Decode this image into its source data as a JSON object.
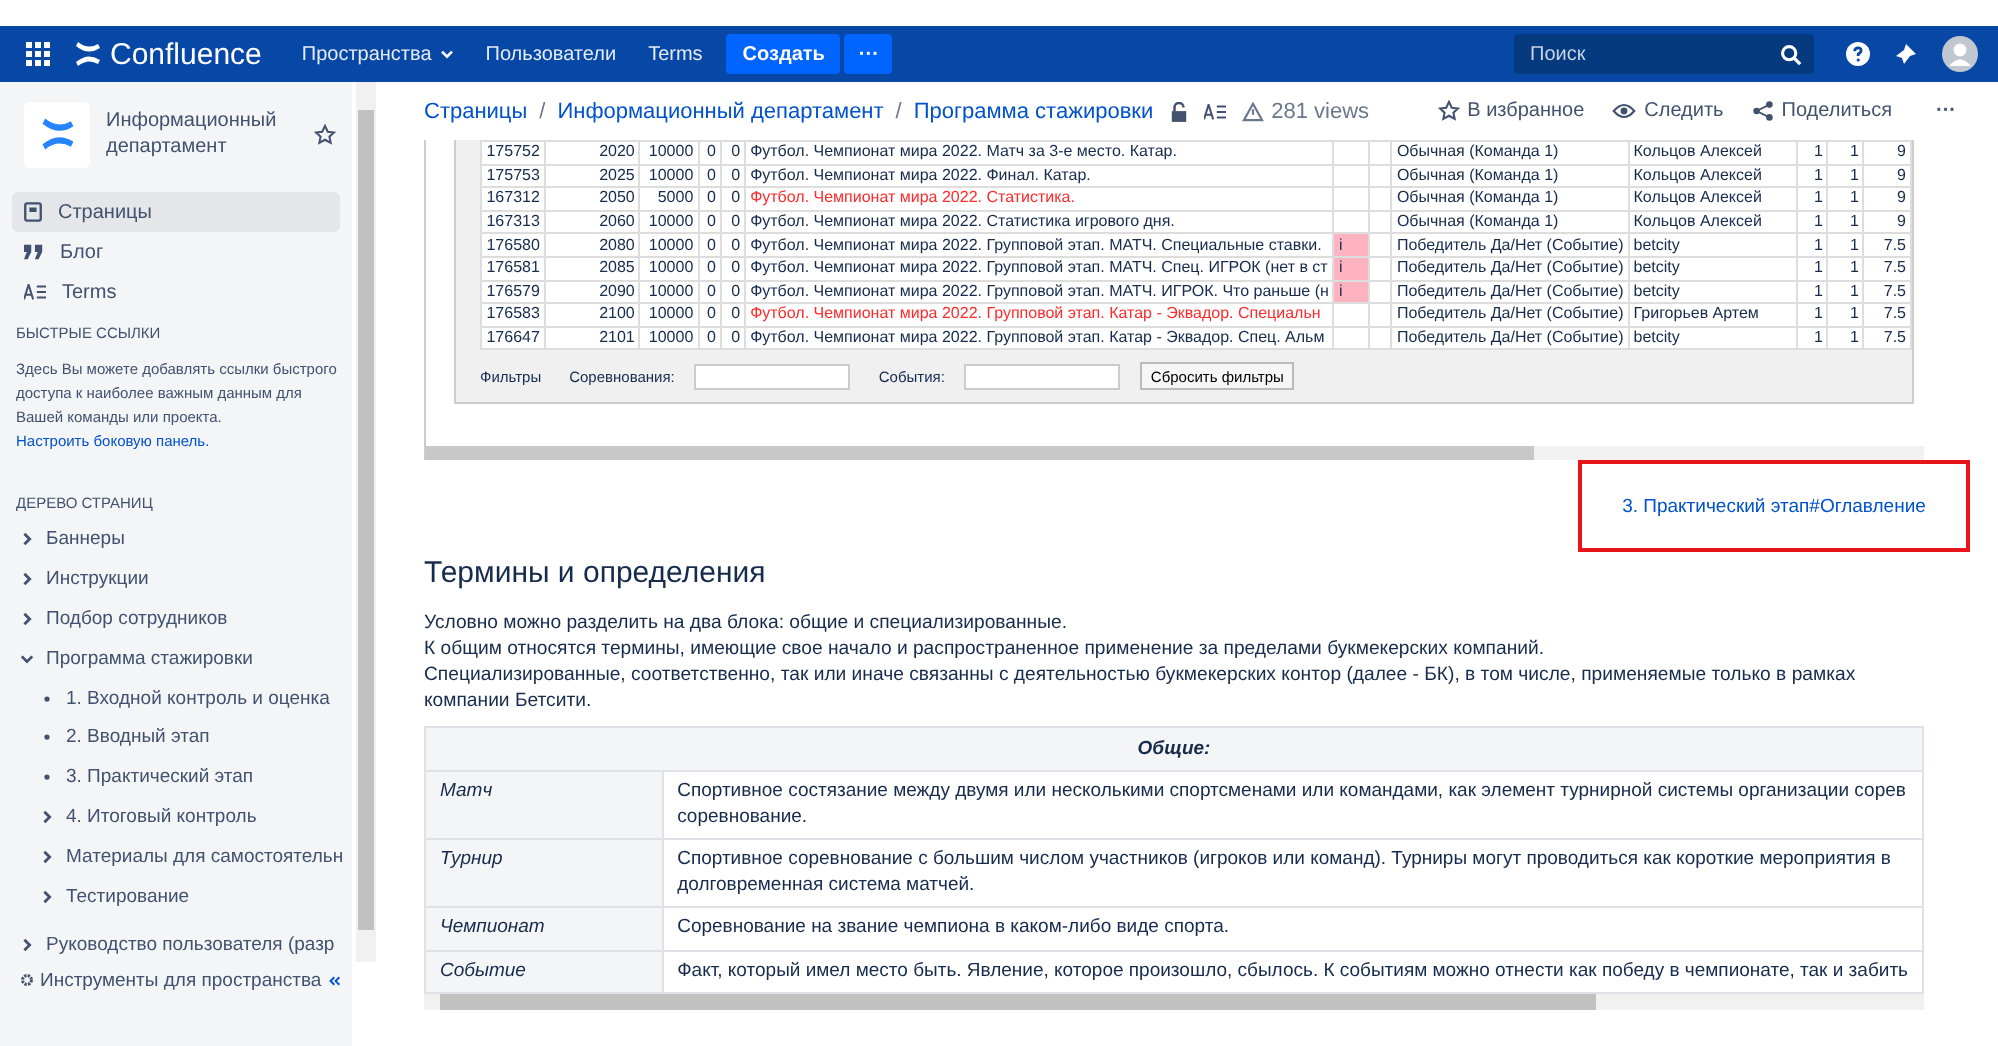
{
  "topbar": {
    "product": "Confluence",
    "menu": [
      {
        "label": "Пространства",
        "dropdown": true
      },
      {
        "label": "Пользователи",
        "dropdown": false
      },
      {
        "label": "Terms",
        "dropdown": false
      }
    ],
    "create": "Создать",
    "more": "···",
    "search": {
      "placeholder": "Поиск"
    }
  },
  "sidebar": {
    "space": "Информационный департамент",
    "nav": [
      {
        "kind": "pages",
        "label": "Страницы",
        "selected": true
      },
      {
        "kind": "blog",
        "label": "Блог",
        "selected": false
      },
      {
        "kind": "terms",
        "label": "Terms",
        "selected": false
      }
    ],
    "quick_links_title": "БЫСТРЫЕ ССЫЛКИ",
    "quick_links_text": "Здесь Вы можете добавлять ссылки быстрого доступа к наиболее важным данным для Вашей команды или проекта.",
    "quick_links_link": "Настроить боковую панель.",
    "tree_title": "ДЕРЕВО СТРАНИЦ",
    "tree": [
      {
        "label": "Баннеры",
        "kind": "branch",
        "expanded": false
      },
      {
        "label": "Инструкции",
        "kind": "branch",
        "expanded": false
      },
      {
        "label": "Подбор сотрудников",
        "kind": "branch",
        "expanded": false
      },
      {
        "label": "Программа стажировки",
        "kind": "branch",
        "expanded": true,
        "children": [
          {
            "label": "1. Входной контроль и оценка",
            "kind": "leaf"
          },
          {
            "label": "2. Вводный этап",
            "kind": "leaf"
          },
          {
            "label": "3. Практический этап",
            "kind": "leaf"
          },
          {
            "label": "4. Итоговый контроль",
            "kind": "branch",
            "expanded": false
          },
          {
            "label": "Материалы для самостоятельн",
            "kind": "branch",
            "expanded": false
          },
          {
            "label": "Тестирование",
            "kind": "branch",
            "expanded": false
          }
        ]
      }
    ],
    "tree_more": [
      {
        "label": "Руководство пользователя (разр",
        "kind": "branch",
        "expanded": false
      }
    ],
    "tools": "Инструменты для пространства"
  },
  "breadcrumbs": [
    "Страницы",
    "Информационный департамент",
    "Программа стажировки"
  ],
  "breadcrumb_separator": "/",
  "views": "281 views",
  "actions": [
    {
      "kind": "star",
      "label": "В избранное"
    },
    {
      "kind": "watch",
      "label": "Следить"
    },
    {
      "kind": "share",
      "label": "Поделиться"
    }
  ],
  "actions_more": "···",
  "embedded": {
    "rows": [
      {
        "cells": [
          "175752",
          "2020",
          "10000",
          "0",
          "0",
          "Футбол. Чемпионат мира 2022. Матч за 3-е место. Катар.",
          "Обычная (Команда 1)",
          "Кольцов Алексей",
          "1",
          "1",
          "9"
        ],
        "red": false
      },
      {
        "cells": [
          "175753",
          "2025",
          "10000",
          "0",
          "0",
          "Футбол. Чемпионат мира 2022. Финал. Катар.",
          "Обычная (Команда 1)",
          "Кольцов Алексей",
          "1",
          "1",
          "9"
        ],
        "red": false
      },
      {
        "cells": [
          "167312",
          "2050",
          "5000",
          "0",
          "0",
          "Футбол. Чемпионат мира 2022. Статистика.",
          "Обычная (Команда 1)",
          "Кольцов Алексей",
          "1",
          "1",
          "9"
        ],
        "red": true
      },
      {
        "cells": [
          "167313",
          "2060",
          "10000",
          "0",
          "0",
          "Футбол. Чемпионат мира 2022. Статистика игрового дня.",
          "Обычная (Команда 1)",
          "Кольцов Алексей",
          "1",
          "1",
          "9"
        ],
        "red": false
      },
      {
        "cells": [
          "176580",
          "2080",
          "10000",
          "0",
          "0",
          "Футбол. Чемпионат мира 2022. Групповой этап. МАТЧ. Специальные ставки.",
          "Победитель Да/Нет (Событие)",
          "betcity",
          "1",
          "1",
          "7.5"
        ],
        "red": false,
        "marker": "i"
      },
      {
        "cells": [
          "176581",
          "2085",
          "10000",
          "0",
          "0",
          "Футбол. Чемпионат мира 2022. Групповой этап. МАТЧ. Спец. ИГРОК (нет в ст",
          "Победитель Да/Нет (Событие)",
          "betcity",
          "1",
          "1",
          "7.5"
        ],
        "red": false,
        "marker": "i"
      },
      {
        "cells": [
          "176579",
          "2090",
          "10000",
          "0",
          "0",
          "Футбол. Чемпионат мира 2022. Групповой этап. МАТЧ. ИГРОК. Что раньше (н",
          "Победитель Да/Нет (Событие)",
          "betcity",
          "1",
          "1",
          "7.5"
        ],
        "red": false,
        "marker": "i"
      },
      {
        "cells": [
          "176583",
          "2100",
          "10000",
          "0",
          "0",
          "Футбол. Чемпионат мира 2022. Групповой этап. Катар - Эквадор. Специальн",
          "Победитель Да/Нет (Событие)",
          "Григорьев Артем",
          "1",
          "1",
          "7.5"
        ],
        "red": true
      },
      {
        "cells": [
          "176647",
          "2101",
          "10000",
          "0",
          "0",
          "Футбол. Чемпионат мира 2022. Групповой этап. Катар - Эквадор. Спец. Альм",
          "Победитель Да/Нет (Событие)",
          "betcity",
          "1",
          "1",
          "7.5"
        ],
        "red": false
      }
    ],
    "filters": {
      "label": "Фильтры",
      "competitions": "Соревнования:",
      "events": "События:",
      "reset": "Сбросить фильтры"
    }
  },
  "anchor_link": "3. Практический этап#Оглавление",
  "heading": "Термины и определения",
  "paragraphs": [
    "Условно можно разделить на два блока: общие и специализированные.",
    "К общим относятся термины, имеющие свое начало и распространенное применение за пределами букмекерских компаний.",
    "Специализированные, соответственно, так или иначе связанны с деятельностью букмекерских контор (далее - БК), в том числе, применяемые только в рамках компании Бетсити."
  ],
  "terms_table": {
    "header": "Общие:",
    "rows": [
      {
        "term": "Матч",
        "definition": [
          "Спортивное состязание между двумя или несколькими спортсменами или командами, как элемент турнирной системы организации сорев",
          "соревнование."
        ]
      },
      {
        "term": "Турнир",
        "definition": [
          "Спортивное соревнование с большим числом участников (игроков или команд). Турниры могут проводиться как короткие мероприятия в",
          "долговременная система матчей."
        ]
      },
      {
        "term": "Чемпионат",
        "definition": [
          "Соревнование на звание чемпиона в каком-либо виде спорта."
        ]
      },
      {
        "term": "Событие",
        "definition": [
          "Факт, который имел место быть. Явление, которое произошло, сбылось. К событиям можно отнести как победу в чемпионате, так и забить"
        ]
      }
    ]
  }
}
